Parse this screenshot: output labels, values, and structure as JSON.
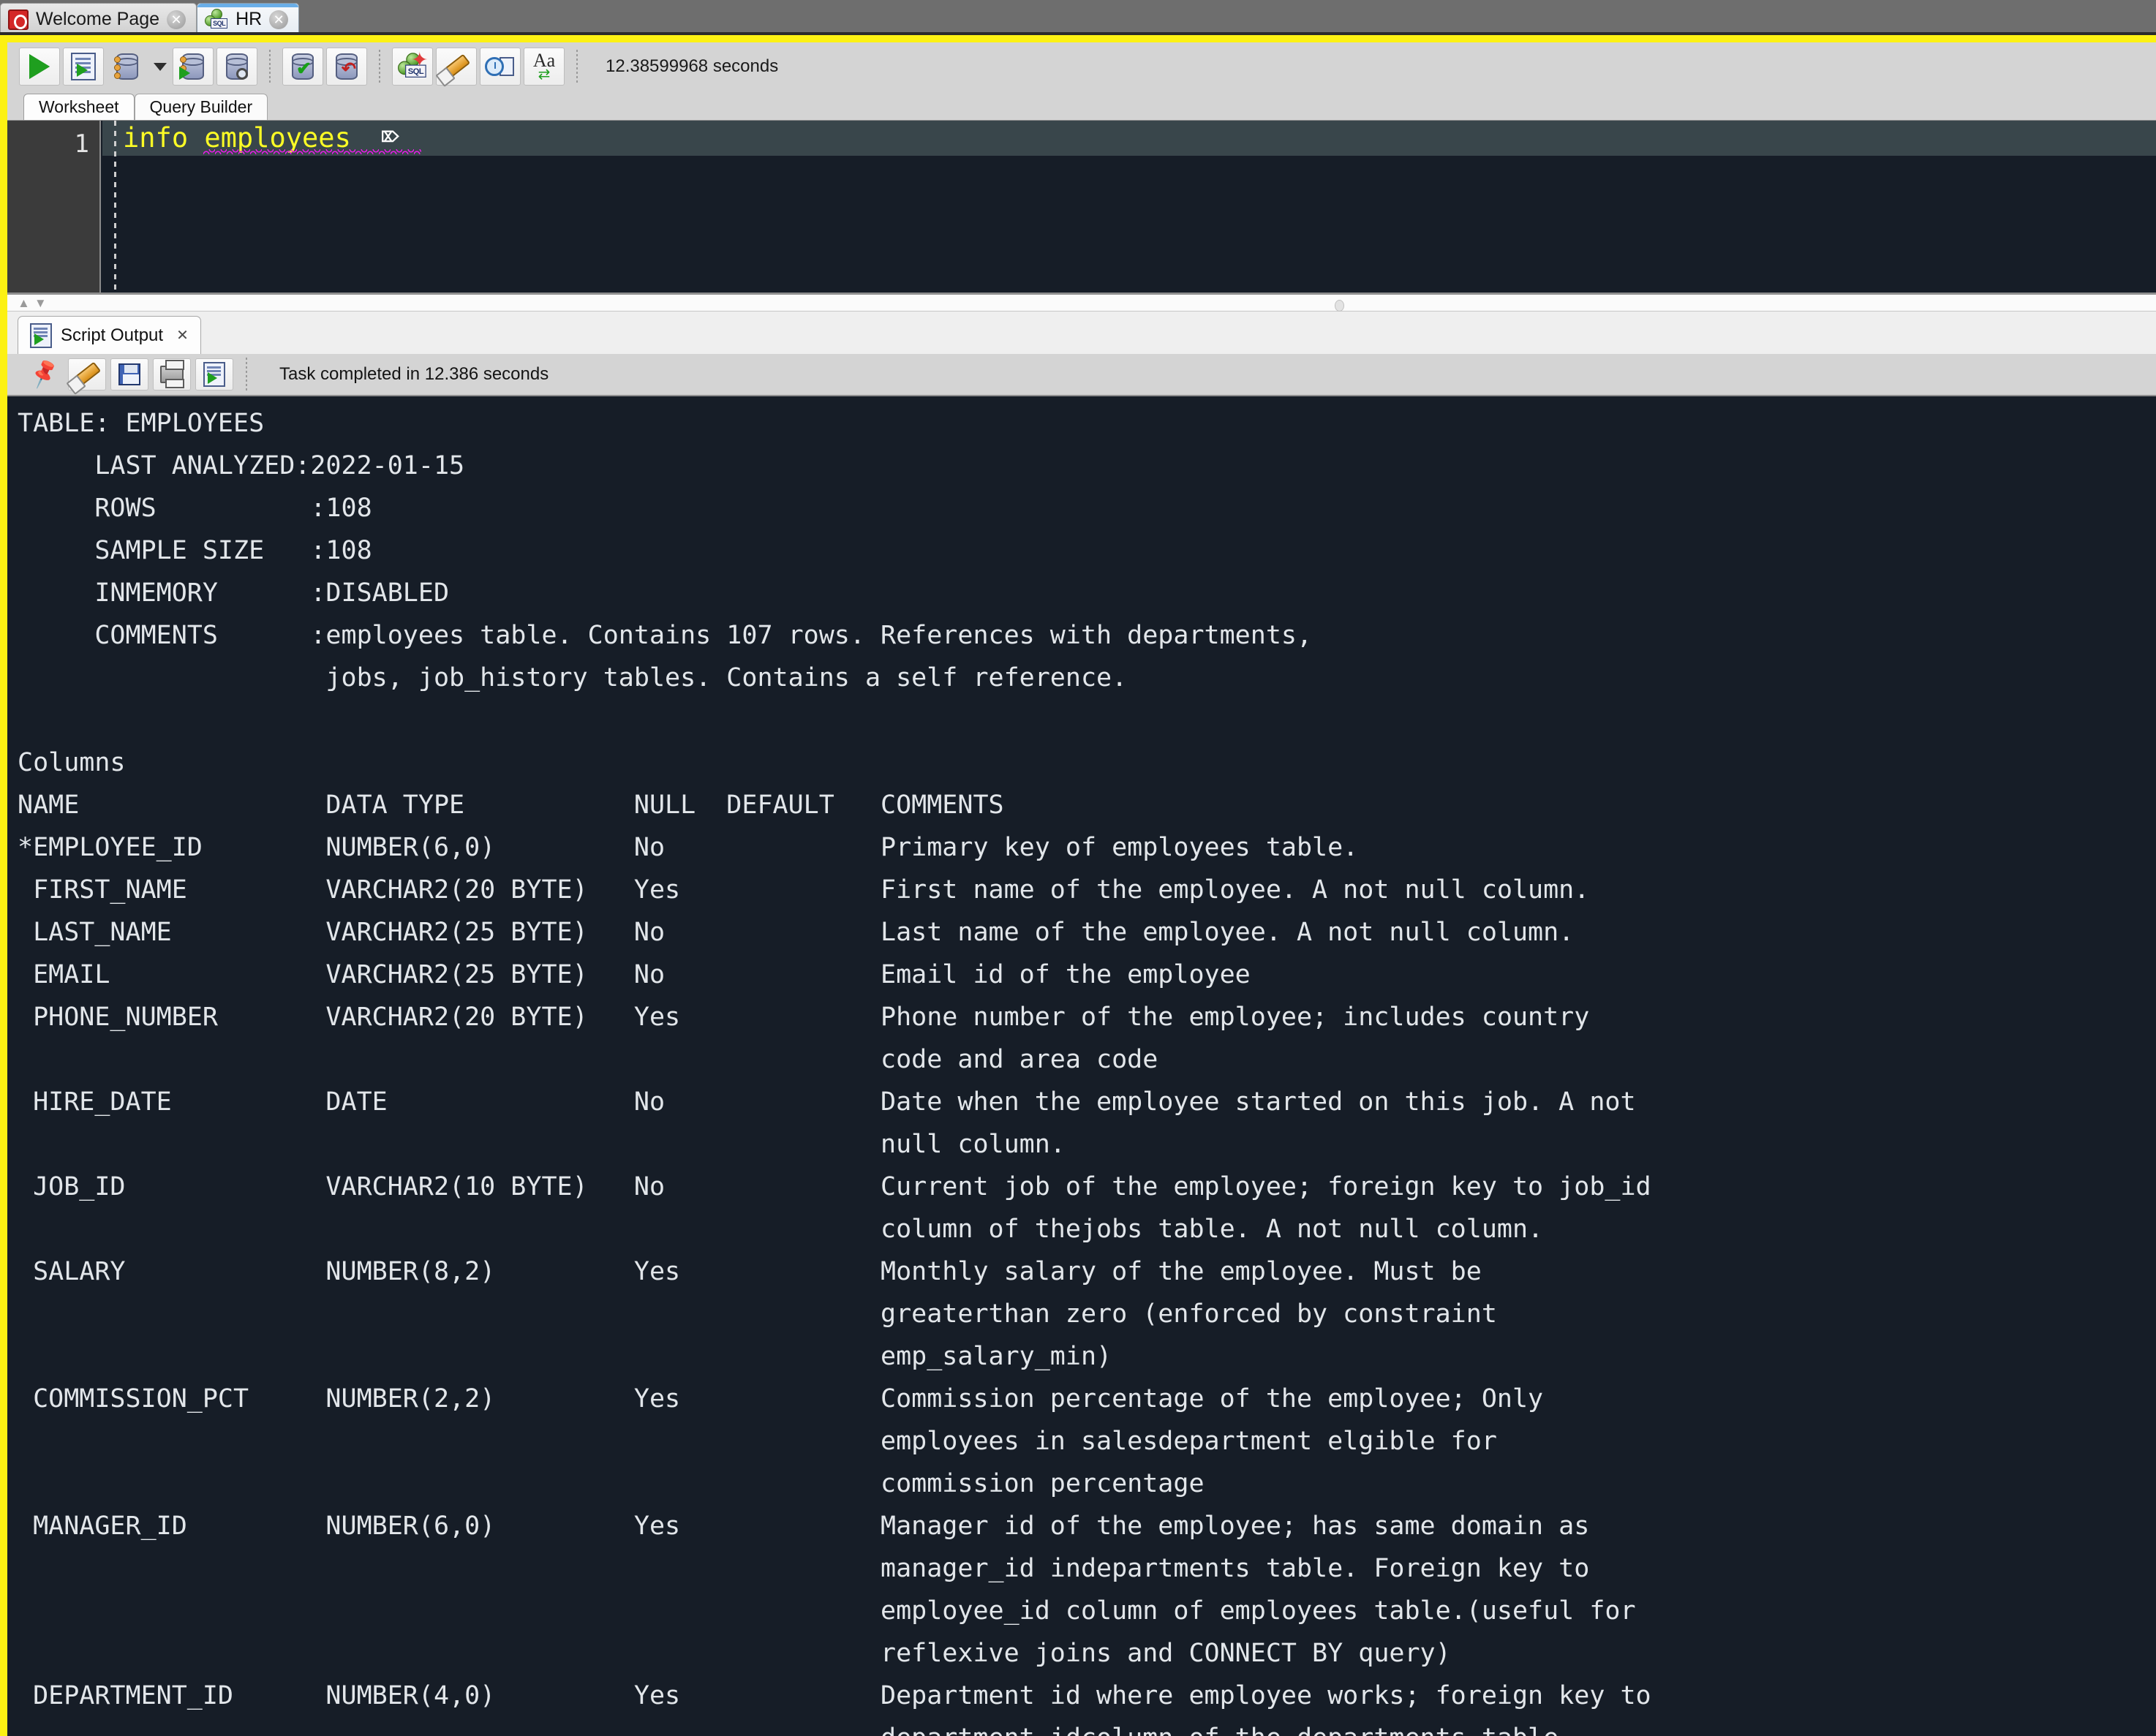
{
  "window": {
    "accent_yellow": "#fcf113",
    "console_bg": "#161d27",
    "editor_text_color": "#fbfb26",
    "error_underline_color": "#e81ce8"
  },
  "document_tabs": [
    {
      "label": "Welcome Page",
      "icon": "oracle-logo-icon",
      "close_label": "✕",
      "active": false
    },
    {
      "label": "HR",
      "icon": "sql-connection-icon",
      "close_label": "✕",
      "active": true
    }
  ],
  "toolbar": {
    "buttons": [
      {
        "name": "run-statement-button",
        "tooltip": "Run Statement",
        "icon": "green-play-icon"
      },
      {
        "name": "run-script-button",
        "tooltip": "Run Script",
        "icon": "script-play-icon"
      },
      {
        "name": "commit-dropdown-button",
        "tooltip": "Autocommit",
        "icon": "database-gear-icon"
      },
      {
        "name": "explain-plan-button",
        "tooltip": "Explain Plan",
        "icon": "database-play-icon"
      },
      {
        "name": "autotrace-button",
        "tooltip": "Autotrace",
        "icon": "database-search-icon"
      },
      {
        "name": "commit-button",
        "tooltip": "Commit",
        "icon": "database-check-icon"
      },
      {
        "name": "rollback-button",
        "tooltip": "Rollback",
        "icon": "database-undo-icon"
      },
      {
        "name": "unshared-worksheet-button",
        "tooltip": "Unshared SQL Worksheet",
        "icon": "sql-star-icon"
      },
      {
        "name": "clear-button",
        "tooltip": "Clear",
        "icon": "eraser-icon"
      },
      {
        "name": "sql-history-button",
        "tooltip": "SQL History",
        "icon": "clock-document-icon"
      },
      {
        "name": "format-button",
        "tooltip": "Change Case",
        "icon": "aa-swap-icon"
      }
    ],
    "timing": "12.38599968 seconds"
  },
  "worksheet_tabs": [
    {
      "label": "Worksheet",
      "active": true
    },
    {
      "label": "Query Builder",
      "active": false
    }
  ],
  "editor": {
    "line_number": "1",
    "code": "info employees",
    "keyword": "info",
    "identifier": "employees"
  },
  "script_output": {
    "tab_label": "Script Output",
    "tab_close": "✕",
    "buttons": [
      {
        "name": "pin-output-button",
        "tooltip": "Pin",
        "icon": "pin-icon"
      },
      {
        "name": "clear-output-button",
        "tooltip": "Clear",
        "icon": "eraser-icon"
      },
      {
        "name": "save-output-button",
        "tooltip": "Save",
        "icon": "floppy-disk-icon"
      },
      {
        "name": "print-output-button",
        "tooltip": "Print",
        "icon": "printer-icon"
      },
      {
        "name": "open-output-button",
        "tooltip": "Open in new worksheet",
        "icon": "script-play-icon"
      }
    ],
    "status": "Task completed in 12.386 seconds",
    "text": "TABLE: EMPLOYEES\n     LAST ANALYZED:2022-01-15\n     ROWS          :108\n     SAMPLE SIZE   :108\n     INMEMORY      :DISABLED\n     COMMENTS      :employees table. Contains 107 rows. References with departments,\n                    jobs, job_history tables. Contains a self reference.\n\nColumns\nNAME                DATA TYPE           NULL  DEFAULT   COMMENTS\n*EMPLOYEE_ID        NUMBER(6,0)         No              Primary key of employees table.\n FIRST_NAME         VARCHAR2(20 BYTE)   Yes             First name of the employee. A not null column.\n LAST_NAME          VARCHAR2(25 BYTE)   No              Last name of the employee. A not null column.\n EMAIL              VARCHAR2(25 BYTE)   No              Email id of the employee\n PHONE_NUMBER       VARCHAR2(20 BYTE)   Yes             Phone number of the employee; includes country\n                                                        code and area code\n HIRE_DATE          DATE                No              Date when the employee started on this job. A not\n                                                        null column.\n JOB_ID             VARCHAR2(10 BYTE)   No              Current job of the employee; foreign key to job_id\n                                                        column of thejobs table. A not null column.\n SALARY             NUMBER(8,2)         Yes             Monthly salary of the employee. Must be\n                                                        greaterthan zero (enforced by constraint\n                                                        emp_salary_min)\n COMMISSION_PCT     NUMBER(2,2)         Yes             Commission percentage of the employee; Only\n                                                        employees in salesdepartment elgible for\n                                                        commission percentage\n MANAGER_ID         NUMBER(6,0)         Yes             Manager id of the employee; has same domain as\n                                                        manager_id indepartments table. Foreign key to\n                                                        employee_id column of employees table.(useful for\n                                                        reflexive joins and CONNECT BY query)\n DEPARTMENT_ID      NUMBER(4,0)         Yes             Department id where employee works; foreign key to\n                                                        department idcolumn of the departments table"
  }
}
